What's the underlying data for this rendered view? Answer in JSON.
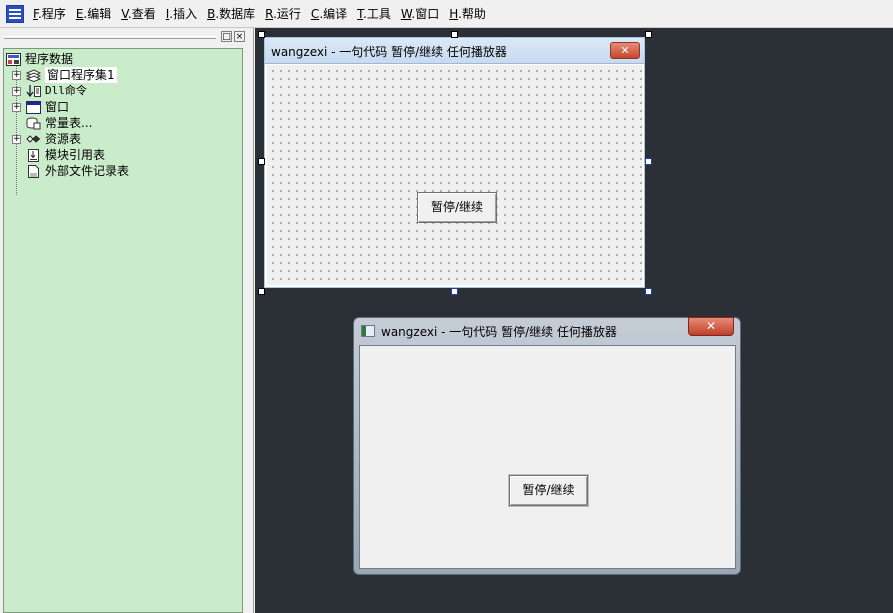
{
  "menu": {
    "items": [
      {
        "key": "F",
        "label": ".程序"
      },
      {
        "key": "E",
        "label": ".编辑"
      },
      {
        "key": "V",
        "label": ".查看"
      },
      {
        "key": "I",
        "label": ".插入"
      },
      {
        "key": "B",
        "label": ".数据库"
      },
      {
        "key": "R",
        "label": ".运行"
      },
      {
        "key": "C",
        "label": ".编译"
      },
      {
        "key": "T",
        "label": ".工具"
      },
      {
        "key": "W",
        "label": ".窗口"
      },
      {
        "key": "H",
        "label": ".帮助"
      }
    ]
  },
  "panel": {
    "pin_label": "□",
    "close_label": "×"
  },
  "tree": {
    "root": "程序数据",
    "items": [
      {
        "label": "窗口程序集1",
        "icon": "layers-icon"
      },
      {
        "label": "Dll命令",
        "icon": "dll-command-icon"
      },
      {
        "label": "窗口",
        "icon": "window-icon"
      },
      {
        "label": "常量表...",
        "icon": "constant-icon"
      },
      {
        "label": "资源表",
        "icon": "resource-icon"
      },
      {
        "label": "模块引用表",
        "icon": "module-ref-icon"
      },
      {
        "label": "外部文件记录表",
        "icon": "external-file-icon"
      }
    ],
    "expander": "+"
  },
  "design_window": {
    "title": "wangzexi - 一句代码 暂停/继续 任何播放器",
    "close_label": "✕",
    "button_label": "暂停/继续"
  },
  "run_window": {
    "title": "wangzexi - 一句代码 暂停/继续 任何播放器",
    "close_label": "✕",
    "button_label": "暂停/继续"
  },
  "colors": {
    "tree_bg": "#cbeccb",
    "workspace_bg": "#2b2f36",
    "close_red": "#c7452c"
  }
}
